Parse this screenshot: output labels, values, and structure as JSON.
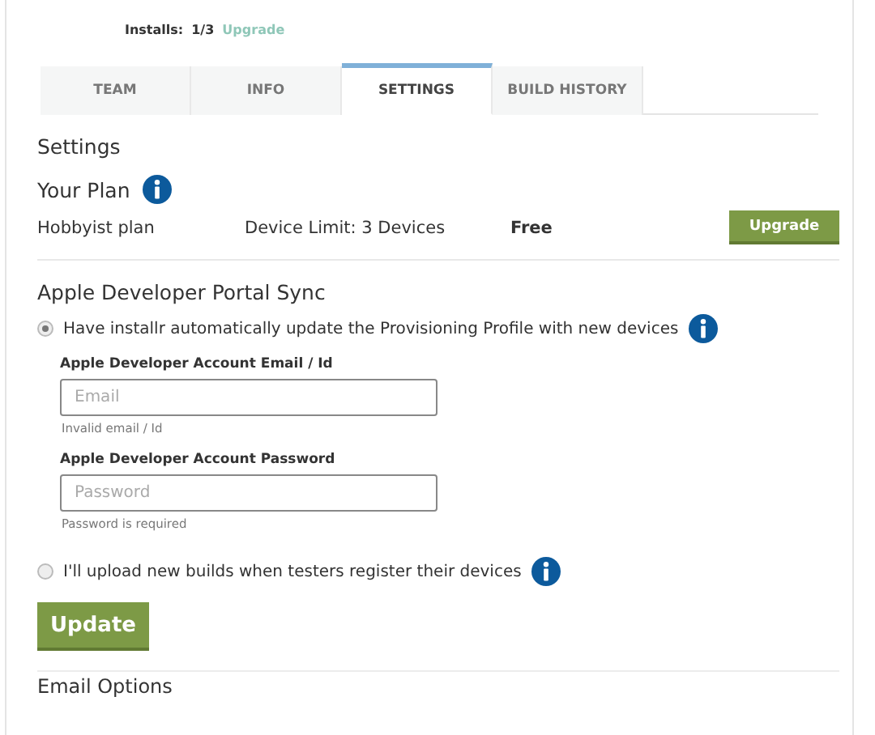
{
  "installs": {
    "label": "Installs:",
    "value": "1/3",
    "link": "Upgrade"
  },
  "tabs": [
    {
      "label": "TEAM",
      "selected": false
    },
    {
      "label": "INFO",
      "selected": false
    },
    {
      "label": "SETTINGS",
      "selected": true
    },
    {
      "label": "BUILD HISTORY",
      "selected": false
    }
  ],
  "heading": "Settings",
  "plan": {
    "title": "Your Plan",
    "name": "Hobbyist plan",
    "limit": "Device Limit: 3 Devices",
    "price": "Free",
    "button": "Upgrade"
  },
  "sync": {
    "title": "Apple Developer Portal Sync",
    "options": [
      {
        "label": "Have installr automatically update the Provisioning Profile with new devices",
        "selected": true
      },
      {
        "label": "I'll upload new builds when testers register their devices",
        "selected": false
      }
    ],
    "fields": [
      {
        "label": "Apple Developer Account Email / Id",
        "placeholder": "Email",
        "hint": "Invalid email / Id"
      },
      {
        "label": "Apple Developer Account Password",
        "placeholder": "Password",
        "hint": "Password is required"
      }
    ],
    "button": "Update"
  },
  "next_section": "Email Options"
}
